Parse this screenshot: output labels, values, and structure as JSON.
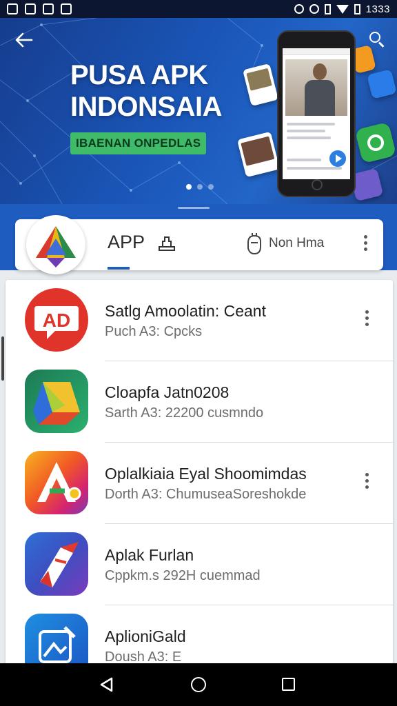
{
  "status_bar": {
    "time": "1333"
  },
  "banner": {
    "headline_line1": "PUSA APK",
    "headline_line2": "INDONSAIA",
    "cta_label": "IBAENAN ONPEDLAS",
    "slide_count": 3,
    "active_slide": 1
  },
  "tabs": {
    "app_label": "APP",
    "home_label": "Non Hma"
  },
  "apps": [
    {
      "title": "Satlg Amoolatin: Ceant",
      "subtitle": "Puch A3: Cpcks",
      "icon": "ad-speech-bubble-icon",
      "has_menu": true
    },
    {
      "title": "Cloapfa Jatn0208",
      "subtitle": "Sarth A3: 22200 cusmndo",
      "icon": "drive-triangle-icon",
      "has_menu": false
    },
    {
      "title": "Oplalkiaia Eyal Shoomimdas",
      "subtitle": "Dorth A3: ChumuseaSoreshokde",
      "icon": "colorful-a-icon",
      "has_menu": true
    },
    {
      "title": "Aplak Furlan",
      "subtitle": "Cppkm.s  292H cuemmad",
      "icon": "paper-plane-icon",
      "has_menu": false
    },
    {
      "title": "AplioniGald",
      "subtitle": "Doush A3: E",
      "icon": "image-edit-icon",
      "has_menu": false
    }
  ],
  "colors": {
    "banner_blue": "#1a56b8",
    "accent_blue": "#1f5cc0",
    "cta_green": "#3fbb6a"
  }
}
